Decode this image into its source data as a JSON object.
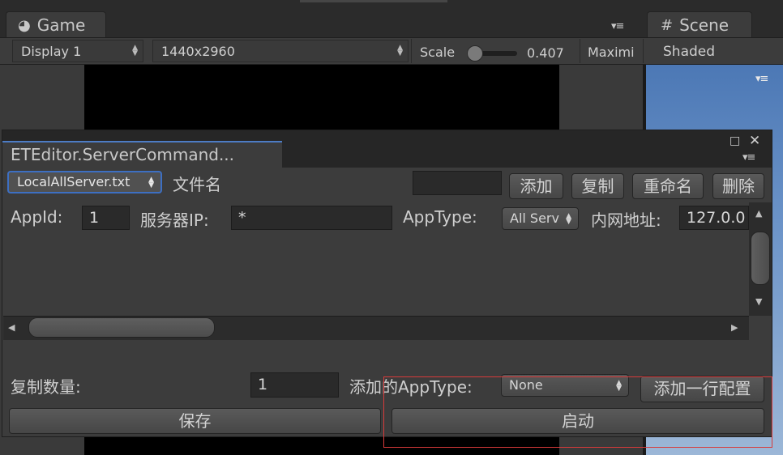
{
  "game_panel": {
    "tab_title": "Game",
    "display": "Display 1",
    "resolution": "1440x2960",
    "scale_label": "Scale",
    "scale_value": "0.407",
    "maximize_label": "Maximi"
  },
  "scene_panel": {
    "tab_title": "Scene",
    "shading_mode": "Shaded"
  },
  "editor_window": {
    "title": "ETEditor.ServerCommand...",
    "file_select": "LocalAllServer.txt",
    "file_name_label": "文件名",
    "file_name_value": "",
    "buttons": {
      "add": "添加",
      "copy": "复制",
      "rename": "重命名",
      "delete": "删除"
    },
    "row": {
      "appid_label": "AppId:",
      "appid_value": "1",
      "server_ip_label": "服务器IP:",
      "server_ip_value": "*",
      "apptype_label": "AppType:",
      "apptype_value": "All Serv",
      "inner_address_label": "内网地址:",
      "inner_address_value": "127.0.0"
    },
    "copy_count_label": "复制数量:",
    "copy_count_value": "1",
    "add_apptype_label": "添加的AppType:",
    "add_apptype_value": "None",
    "add_row_button": "添加一行配置",
    "save_button": "保存",
    "start_button": "启动"
  },
  "colors": {
    "accent_blue": "#3d6fc2",
    "highlight_red": "#d83a3a"
  }
}
